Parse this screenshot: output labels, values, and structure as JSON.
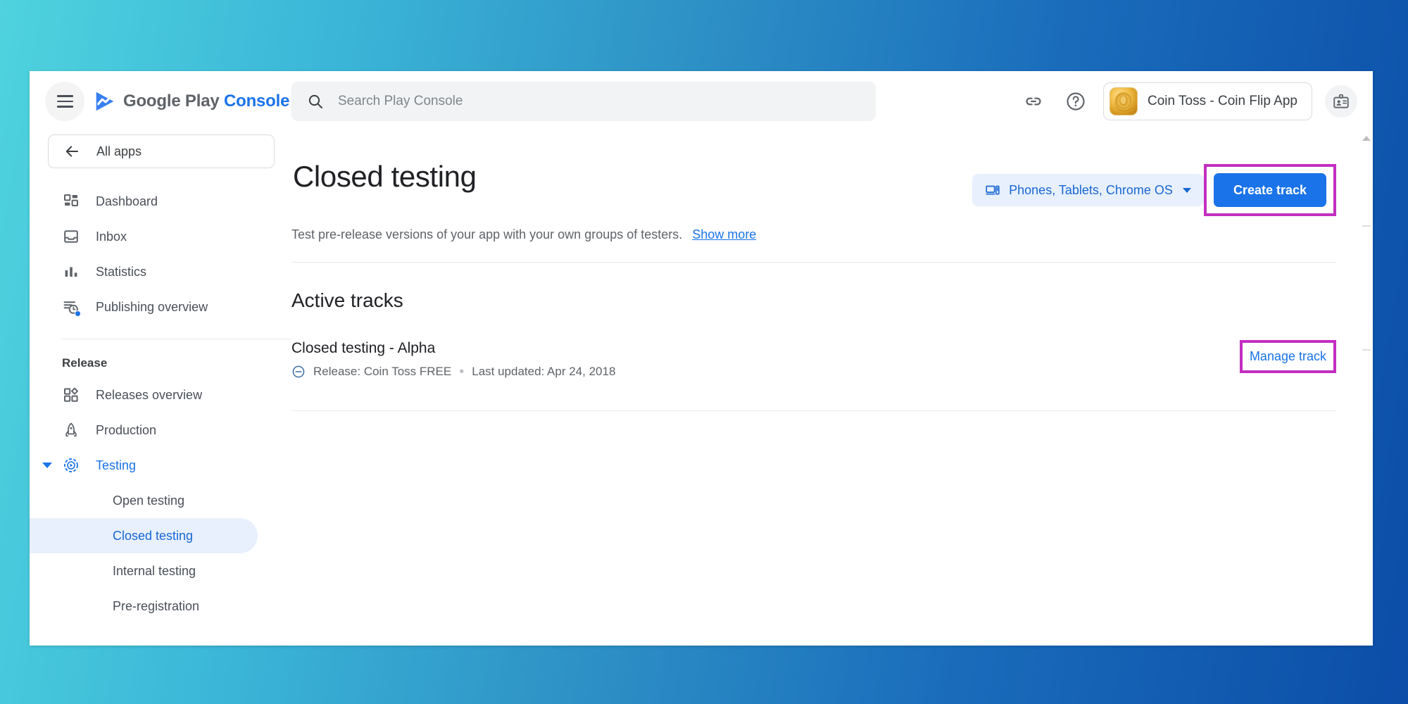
{
  "window": {
    "brand": {
      "google_play": "Google Play",
      "console": "Console"
    },
    "hamburger_label": "Main menu"
  },
  "search": {
    "placeholder": "Search Play Console",
    "value": "",
    "icon": "search-icon"
  },
  "header_actions": {
    "link_icon": "link-icon",
    "help_icon": "help-circle-icon",
    "app_chip_label": "Coin Toss - Coin Flip App",
    "badge_icon": "id-badge-icon"
  },
  "sidebar": {
    "all_apps_label": "All apps",
    "back_icon": "arrow-left-icon",
    "items": [
      {
        "label": "Dashboard",
        "icon": "dashboard-icon",
        "badge": false
      },
      {
        "label": "Inbox",
        "icon": "inbox-icon",
        "badge": false
      },
      {
        "label": "Statistics",
        "icon": "bar-chart-icon",
        "badge": false
      },
      {
        "label": "Publishing overview",
        "icon": "publishing-overview-icon",
        "badge": true
      }
    ],
    "section_label": "Release",
    "release_items": [
      {
        "label": "Releases overview",
        "icon": "releases-overview-icon"
      },
      {
        "label": "Production",
        "icon": "rocket-icon"
      }
    ],
    "testing": {
      "label": "Testing",
      "icon": "testing-icon",
      "caret_icon": "chevron-down-icon",
      "expanded": true,
      "children": [
        {
          "label": "Open testing",
          "selected": false
        },
        {
          "label": "Closed testing",
          "selected": true
        },
        {
          "label": "Internal testing",
          "selected": false
        },
        {
          "label": "Pre-registration",
          "selected": false
        }
      ]
    }
  },
  "main": {
    "page_title": "Closed testing",
    "subtitle": "Test pre-release versions of your app with your own groups of testers.",
    "show_more": "Show more",
    "device_filter": {
      "label": "Phones, Tablets, Chrome OS",
      "icon": "devices-icon"
    },
    "create_track_label": "Create track",
    "section_heading": "Active tracks",
    "tracks": [
      {
        "name": "Closed testing - Alpha",
        "status_icon": "circle-minus-icon",
        "release": "Release: Coin Toss FREE",
        "separator": "•",
        "last_updated": "Last updated: Apr 24, 2018",
        "action_label": "Manage track"
      }
    ]
  },
  "scrollbar": {
    "up_arrow_icon": "scroll-up-arrow-icon"
  },
  "colors": {
    "accent_blue": "#1a73e8",
    "highlight_magenta": "#c22fc0",
    "selected_nav_bg": "#e8f0fe",
    "bg_gradient_start": "#4FD3DE",
    "bg_gradient_end": "#0B4DA8"
  }
}
